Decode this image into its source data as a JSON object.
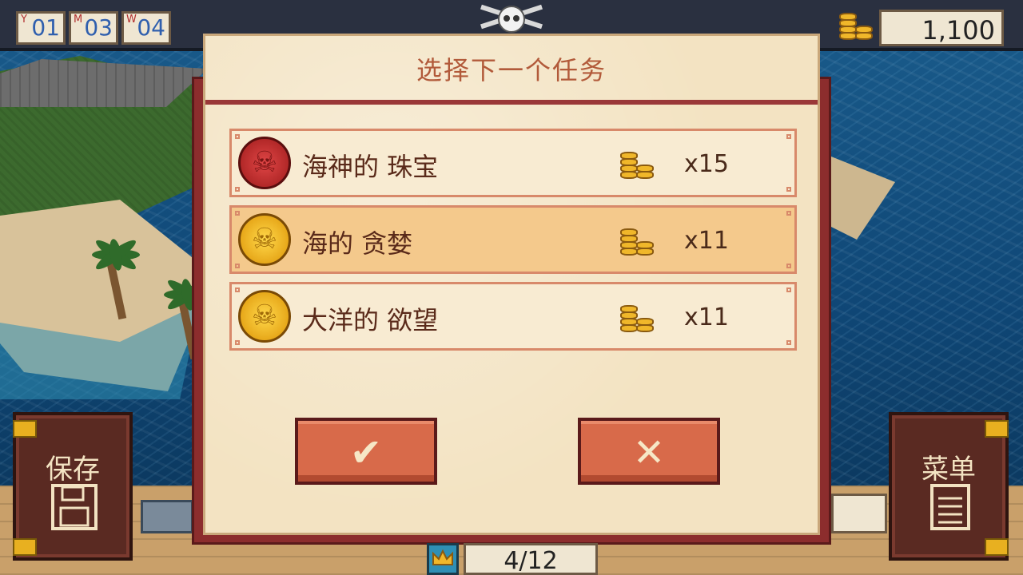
{
  "date": {
    "year": {
      "tag": "Y",
      "value": "01"
    },
    "month": {
      "tag": "M",
      "value": "03"
    },
    "week": {
      "tag": "W",
      "value": "04"
    }
  },
  "gold": {
    "icon": "coin-stack-icon",
    "amount": "1,100"
  },
  "dialog": {
    "title": "选择下一个任务",
    "quests": [
      {
        "name": "海神的 珠宝",
        "medal": "red-skull-medal-icon",
        "reward_icon": "coin-stack-icon",
        "reward": "x15",
        "selected": false
      },
      {
        "name": "海的 贪婪",
        "medal": "gold-skull-medal-icon",
        "reward_icon": "coin-stack-icon",
        "reward": "x11",
        "selected": true
      },
      {
        "name": "大洋的 欲望",
        "medal": "gold-skull-medal-icon",
        "reward_icon": "coin-stack-icon",
        "reward": "x11",
        "selected": false
      }
    ],
    "confirm_glyph": "✔",
    "cancel_glyph": "✕"
  },
  "side_buttons": {
    "save": {
      "label": "保存",
      "icon": "floppy-disk-icon"
    },
    "menu": {
      "label": "菜单",
      "icon": "document-lines-icon"
    }
  },
  "progress": {
    "icon": "crown-icon",
    "value": "4/12"
  },
  "colors": {
    "panel": "#f3e3c2",
    "selected_row": "#f4c98c",
    "button": "#d86a4a",
    "title_text": "#b25a3a",
    "rod": "#8c2d2d"
  }
}
